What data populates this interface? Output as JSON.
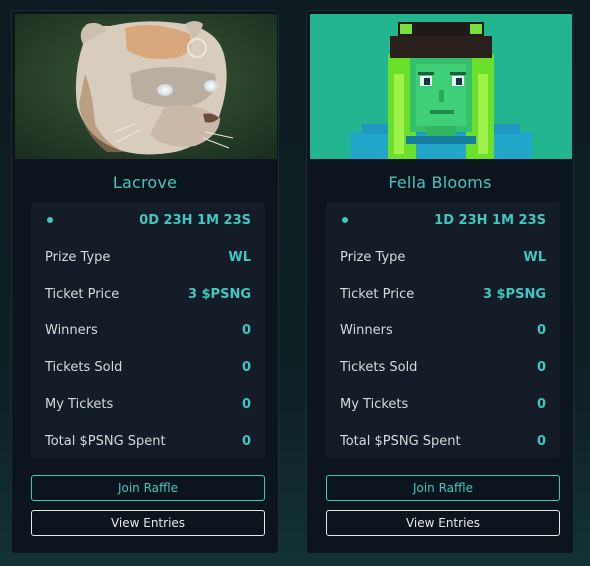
{
  "raffles": [
    {
      "name": "Lacrove",
      "timer": "0D 23H 1M 23S",
      "rows": [
        {
          "label": "Prize Type",
          "value": "WL"
        },
        {
          "label": "Ticket Price",
          "value": "3 $PSNG"
        },
        {
          "label": "Winners",
          "value": "0"
        },
        {
          "label": "Tickets Sold",
          "value": "0"
        },
        {
          "label": "My Tickets",
          "value": "0"
        },
        {
          "label": "Total $PSNG Spent",
          "value": "0"
        }
      ],
      "join_label": "Join Raffle",
      "view_label": "View Entries"
    },
    {
      "name": "Fella Blooms",
      "timer": "1D 23H 1M 23S",
      "rows": [
        {
          "label": "Prize Type",
          "value": "WL"
        },
        {
          "label": "Ticket Price",
          "value": "3 $PSNG"
        },
        {
          "label": "Winners",
          "value": "0"
        },
        {
          "label": "Tickets Sold",
          "value": "0"
        },
        {
          "label": "My Tickets",
          "value": "0"
        },
        {
          "label": "Total $PSNG Spent",
          "value": "0"
        }
      ],
      "join_label": "Join Raffle",
      "view_label": "View Entries"
    }
  ],
  "colors": {
    "accent": "#3ec8bf",
    "card_bg": "#0c141d",
    "stats_bg": "#131c27",
    "text": "#e6e8ea"
  }
}
